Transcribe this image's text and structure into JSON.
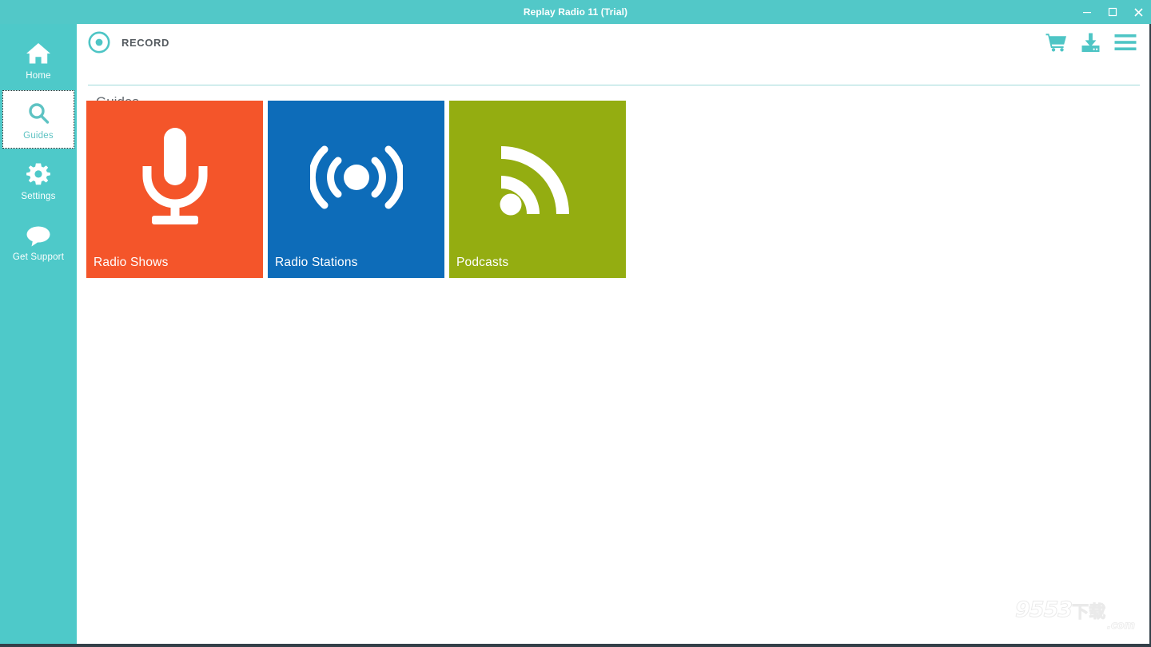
{
  "window": {
    "title": "Replay Radio 11 (Trial)",
    "controls": [
      {
        "name": "minimize",
        "glyph": "minimize-icon"
      },
      {
        "name": "maximize",
        "glyph": "maximize-icon"
      },
      {
        "name": "close",
        "glyph": "close-icon"
      }
    ],
    "titlebar_color": "#52c8c8"
  },
  "sidebar": {
    "background": "#4ec9c9",
    "selected_index": 1,
    "items": [
      {
        "label": "Home",
        "icon": "home-icon",
        "selected": false
      },
      {
        "label": "Guides",
        "icon": "search-icon",
        "selected": true
      },
      {
        "label": "Settings",
        "icon": "gear-icon",
        "selected": false
      },
      {
        "label": "Get Support",
        "icon": "chat-icon",
        "selected": false
      }
    ]
  },
  "header": {
    "logo_icon": "record-target-icon",
    "brand_label": "RECORD",
    "accent_color": "#4ec5c5",
    "actions": [
      {
        "label": "Store",
        "icon": "shopping-cart-icon"
      },
      {
        "label": "Downloads",
        "icon": "download-icon"
      },
      {
        "label": "Menu",
        "icon": "hamburger-menu-icon"
      }
    ]
  },
  "main": {
    "page_title": "Guides",
    "tiles": [
      {
        "label": "Radio Shows",
        "icon": "microphone-icon",
        "color": "#f4552a"
      },
      {
        "label": "Radio Stations",
        "icon": "broadcast-signal-icon",
        "color": "#0d6cb9"
      },
      {
        "label": "Podcasts",
        "icon": "rss-feed-icon",
        "color": "#94ad11"
      }
    ]
  },
  "watermark": {
    "number": "9553",
    "cn_text": "下载",
    "domain": ".com"
  }
}
